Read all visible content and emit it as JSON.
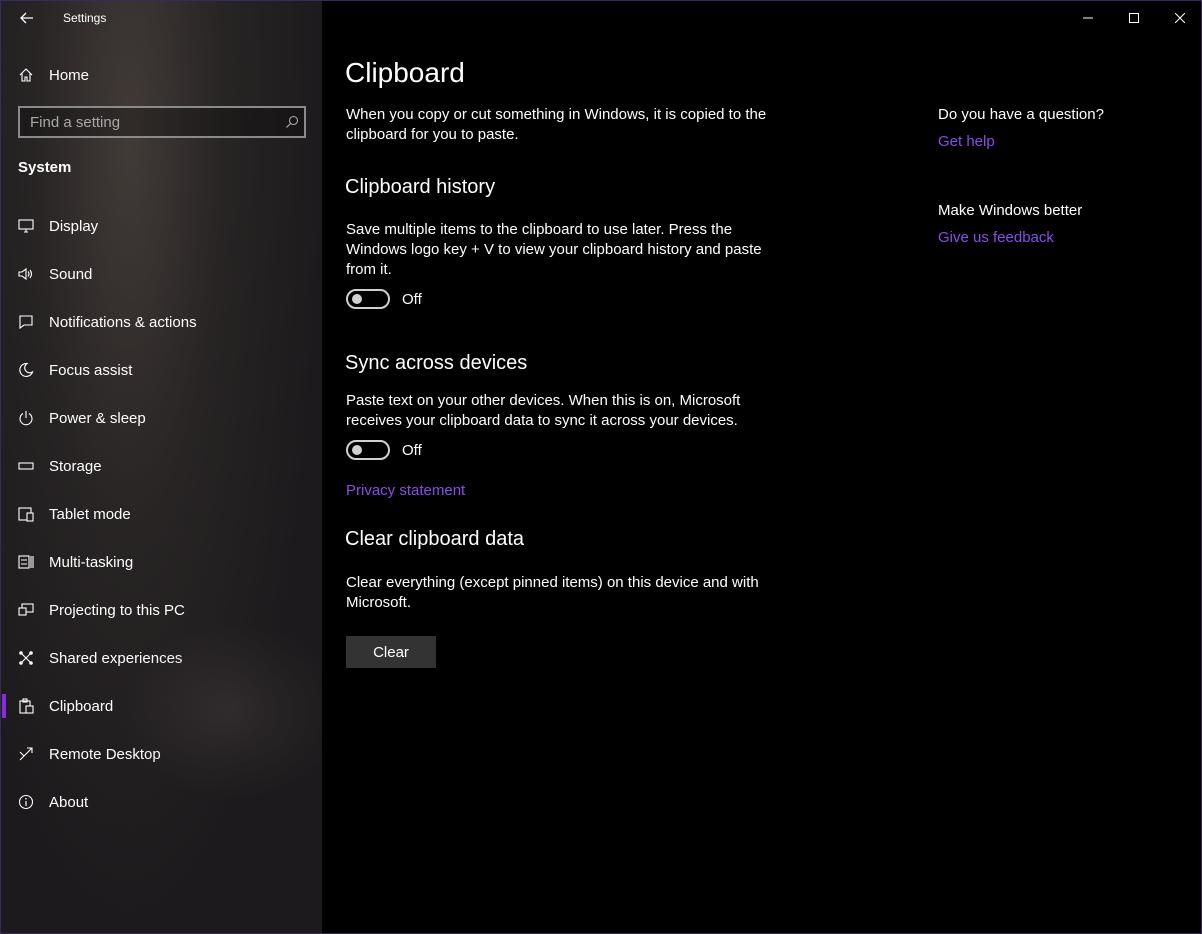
{
  "window": {
    "title": "Settings"
  },
  "sidebar": {
    "home_label": "Home",
    "search_placeholder": "Find a setting",
    "section": "System",
    "items": [
      {
        "label": "Display",
        "icon": "display-icon"
      },
      {
        "label": "Sound",
        "icon": "sound-icon"
      },
      {
        "label": "Notifications & actions",
        "icon": "notifications-icon"
      },
      {
        "label": "Focus assist",
        "icon": "moon-icon"
      },
      {
        "label": "Power & sleep",
        "icon": "power-icon"
      },
      {
        "label": "Storage",
        "icon": "storage-icon"
      },
      {
        "label": "Tablet mode",
        "icon": "tablet-icon"
      },
      {
        "label": "Multi-tasking",
        "icon": "multitasking-icon"
      },
      {
        "label": "Projecting to this PC",
        "icon": "projecting-icon"
      },
      {
        "label": "Shared experiences",
        "icon": "shared-experiences-icon"
      },
      {
        "label": "Clipboard",
        "icon": "clipboard-icon",
        "active": true
      },
      {
        "label": "Remote Desktop",
        "icon": "remote-desktop-icon"
      },
      {
        "label": "About",
        "icon": "info-icon"
      }
    ]
  },
  "main": {
    "title": "Clipboard",
    "intro": "When you copy or cut something in Windows, it is copied to the clipboard for you to paste.",
    "history": {
      "heading": "Clipboard history",
      "description": "Save multiple items to the clipboard to use later. Press the Windows logo key + V to view your clipboard history and paste from it.",
      "toggle_state": "Off"
    },
    "sync": {
      "heading": "Sync across devices",
      "description": "Paste text on your other devices. When this is on, Microsoft receives your clipboard data to sync it across your devices.",
      "toggle_state": "Off",
      "privacy_link": "Privacy statement"
    },
    "clear": {
      "heading": "Clear clipboard data",
      "description": "Clear everything (except pinned items) on this device and with Microsoft.",
      "button_label": "Clear"
    }
  },
  "aside": {
    "question": "Do you have a question?",
    "help_link": "Get help",
    "improve": "Make Windows better",
    "feedback_link": "Give us feedback"
  },
  "colors": {
    "accent": "#8a2be2",
    "link": "#8a4ce6",
    "background": "#000000"
  }
}
